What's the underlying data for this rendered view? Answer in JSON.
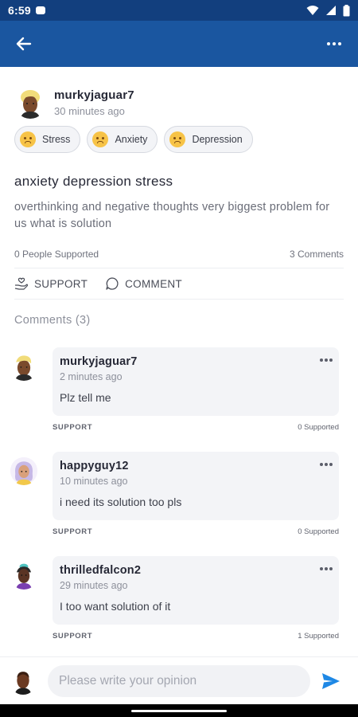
{
  "status_bar": {
    "time": "6:59"
  },
  "post": {
    "author": "murkyjaguar7",
    "time_ago": "30 minutes ago",
    "tags": [
      {
        "label": "Stress",
        "icon": "worried-face-icon"
      },
      {
        "label": "Anxiety",
        "icon": "anxious-face-icon"
      },
      {
        "label": "Depression",
        "icon": "sad-face-icon"
      }
    ],
    "title": "anxiety depression stress",
    "body": "overthinking and negative thoughts very biggest problem for us what is solution",
    "supported_count": "0 People Supported",
    "comments_count": "3 Comments",
    "support_label": "SUPPORT",
    "comment_label": "COMMENT"
  },
  "comments_title": "Comments (3)",
  "comments": [
    {
      "author": "murkyjaguar7",
      "time_ago": "2 minutes ago",
      "text": "Plz tell me",
      "support_label": "SUPPORT",
      "supported": "0 Supported"
    },
    {
      "author": "happyguy12",
      "time_ago": "10 minutes ago",
      "text": "i need its solution too pls",
      "support_label": "SUPPORT",
      "supported": "0 Supported"
    },
    {
      "author": "thrilledfalcon2",
      "time_ago": "29 minutes ago",
      "text": "I too want solution of it",
      "support_label": "SUPPORT",
      "supported": "1 Supported"
    }
  ],
  "composer": {
    "placeholder": "Please write your opinion"
  },
  "colors": {
    "status_bar": "#123f7e",
    "app_bar": "#1a56a0",
    "send": "#1e88e5"
  }
}
